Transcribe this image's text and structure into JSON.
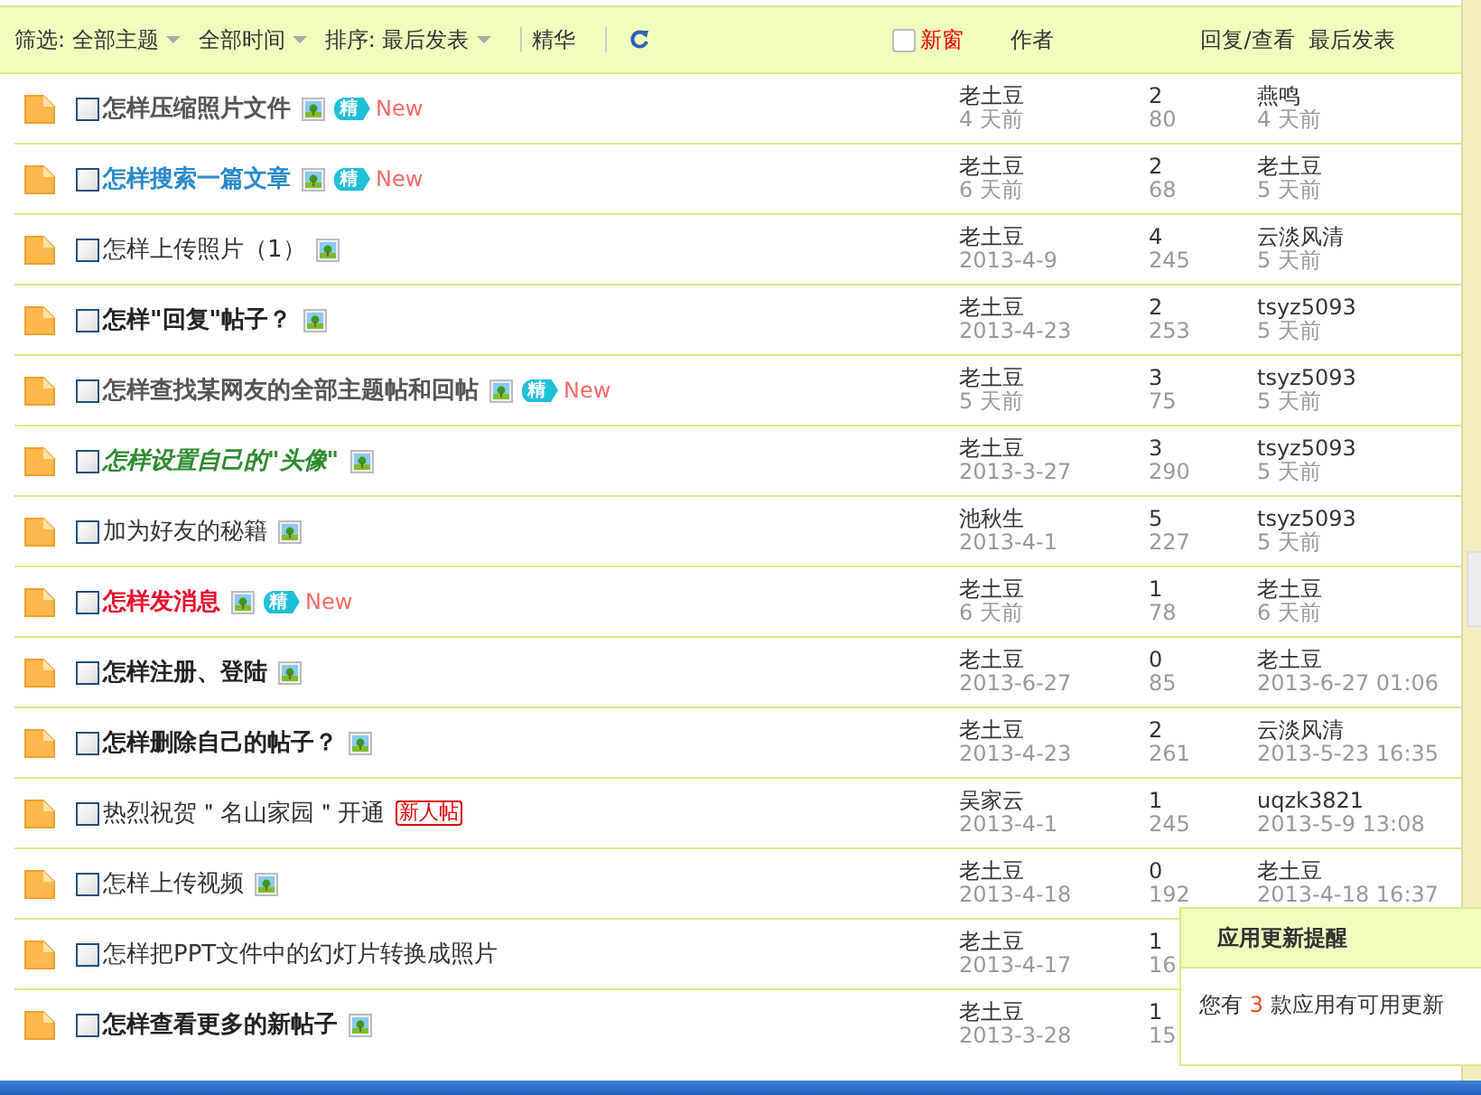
{
  "toolbar": {
    "filters": [
      {
        "label": "筛选: 全部主题",
        "dropdown": true
      },
      {
        "label": "全部时间",
        "dropdown": true
      },
      {
        "label": "排序: 最后发表",
        "dropdown": true
      }
    ],
    "digest_filter": "精华",
    "new_window": {
      "label": "新窗",
      "checked": false
    }
  },
  "columns": [
    "作者",
    "回复/查看",
    "最后发表"
  ],
  "threads": [
    {
      "title": "怎样压缩照片文件",
      "kind": "grey",
      "checked": false,
      "has_image": true,
      "digest": "精",
      "is_new": "New",
      "author": "老土豆",
      "posted": "4 天前",
      "replies": "2",
      "views": "80",
      "last_user": "燕鸣",
      "last_time": "4 天前"
    },
    {
      "title": "怎样搜索一篇文章",
      "kind": "blue",
      "checked": false,
      "has_image": true,
      "digest": "精",
      "is_new": "New",
      "author": "老土豆",
      "posted": "6 天前",
      "replies": "2",
      "views": "68",
      "last_user": "老土豆",
      "last_time": "5 天前"
    },
    {
      "title": "怎样上传照片（1）",
      "kind": "plain",
      "checked": false,
      "has_image": true,
      "author": "老土豆",
      "posted": "2013-4-9",
      "replies": "4",
      "views": "245",
      "last_user": "云淡风清",
      "last_time": "5 天前"
    },
    {
      "title": "怎样\"回复\"帖子？",
      "kind": "bold",
      "checked": false,
      "has_image": true,
      "author": "老土豆",
      "posted": "2013-4-23",
      "replies": "2",
      "views": "253",
      "last_user": "tsyz5093",
      "last_time": "5 天前"
    },
    {
      "title": "怎样查找某网友的全部主题帖和回帖",
      "kind": "grey",
      "checked": false,
      "has_image": true,
      "digest": "精",
      "is_new": "New",
      "author": "老土豆",
      "posted": "5 天前",
      "replies": "3",
      "views": "75",
      "last_user": "tsyz5093",
      "last_time": "5 天前"
    },
    {
      "title": "怎样设置自己的\"头像\"",
      "kind": "green",
      "checked": false,
      "has_image": true,
      "author": "老土豆",
      "posted": "2013-3-27",
      "replies": "3",
      "views": "290",
      "last_user": "tsyz5093",
      "last_time": "5 天前"
    },
    {
      "title": "加为好友的秘籍",
      "kind": "plain",
      "checked": false,
      "has_image": true,
      "author": "池秋生",
      "posted": "2013-4-1",
      "replies": "5",
      "views": "227",
      "last_user": "tsyz5093",
      "last_time": "5 天前"
    },
    {
      "title": "怎样发消息",
      "kind": "red",
      "checked": false,
      "has_image": true,
      "digest": "精",
      "is_new": "New",
      "author": "老土豆",
      "posted": "6 天前",
      "replies": "1",
      "views": "78",
      "last_user": "老土豆",
      "last_time": "6 天前"
    },
    {
      "title": "怎样注册、登陆",
      "kind": "bold",
      "checked": false,
      "has_image": true,
      "author": "老土豆",
      "posted": "2013-6-27",
      "replies": "0",
      "views": "85",
      "last_user": "老土豆",
      "last_time": "2013-6-27 01:06"
    },
    {
      "title": "怎样删除自己的帖子？",
      "kind": "bold",
      "checked": false,
      "has_image": true,
      "author": "老土豆",
      "posted": "2013-4-23",
      "replies": "2",
      "views": "261",
      "last_user": "云淡风清",
      "last_time": "2013-5-23 16:35"
    },
    {
      "title": "热烈祝贺＂名山家园＂开通",
      "kind": "plain",
      "checked": false,
      "has_image": false,
      "tag": "新人帖",
      "author": "吴家云",
      "posted": "2013-4-1",
      "replies": "1",
      "views": "245",
      "last_user": "uqzk3821",
      "last_time": "2013-5-9 13:08"
    },
    {
      "title": "怎样上传视频",
      "kind": "plain",
      "checked": false,
      "has_image": true,
      "author": "老土豆",
      "posted": "2013-4-18",
      "replies": "0",
      "views": "192",
      "last_user": "老土豆",
      "last_time": "2013-4-18 16:37"
    },
    {
      "title": "怎样把PPT文件中的幻灯片转换成照片",
      "kind": "plain",
      "checked": false,
      "has_image": false,
      "author": "老土豆",
      "posted": "2013-4-17",
      "replies": "1",
      "views": "16"
    },
    {
      "title": "怎样查看更多的新帖子",
      "kind": "bold",
      "checked": false,
      "has_image": true,
      "author": "老土豆",
      "posted": "2013-3-28",
      "replies": "1",
      "views": "15"
    }
  ],
  "popup": {
    "title": "应用更新提醒",
    "message_before": "您有",
    "count": "3",
    "message_after": "款应用有可用更新"
  }
}
